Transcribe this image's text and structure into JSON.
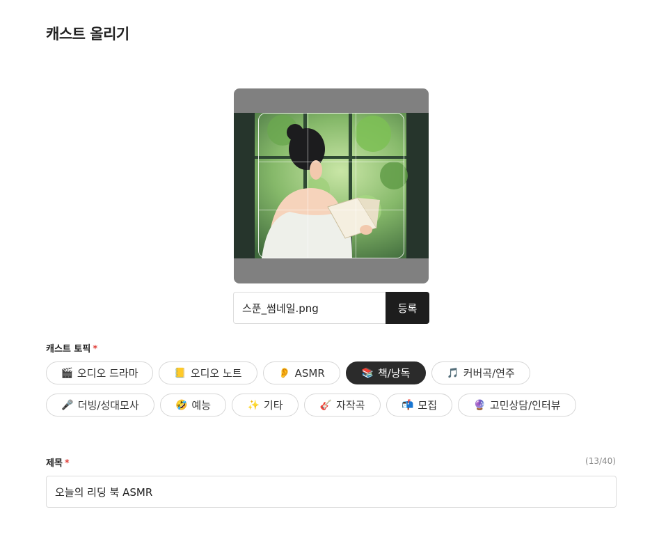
{
  "page": {
    "title": "캐스트 올리기"
  },
  "thumbnail": {
    "file_name": "스푼_썸네일.png",
    "upload_label": "등록"
  },
  "topic": {
    "label": "캐스트 토픽",
    "required_mark": "*",
    "chips": [
      {
        "icon": "🎬",
        "icon_name": "clapper-board-icon",
        "label": "오디오 드라마",
        "selected": false
      },
      {
        "icon": "📒",
        "icon_name": "notebook-icon",
        "label": "오디오 노트",
        "selected": false
      },
      {
        "icon": "👂",
        "icon_name": "ear-icon",
        "label": "ASMR",
        "selected": false
      },
      {
        "icon": "📚",
        "icon_name": "books-icon",
        "label": "책/낭독",
        "selected": true
      },
      {
        "icon": "🎵",
        "icon_name": "music-note-icon",
        "label": "커버곡/연주",
        "selected": false
      },
      {
        "icon": "🎤",
        "icon_name": "microphone-icon",
        "label": "더빙/성대모사",
        "selected": false
      },
      {
        "icon": "🤣",
        "icon_name": "laughing-face-icon",
        "label": "예능",
        "selected": false
      },
      {
        "icon": "✨",
        "icon_name": "sparkles-icon",
        "label": "기타",
        "selected": false
      },
      {
        "icon": "🎸",
        "icon_name": "guitar-icon",
        "label": "자작곡",
        "selected": false
      },
      {
        "icon": "📬",
        "icon_name": "mailbox-icon",
        "label": "모집",
        "selected": false
      },
      {
        "icon": "🔮",
        "icon_name": "crystal-ball-icon",
        "label": "고민상담/인터뷰",
        "selected": false
      }
    ]
  },
  "title_field": {
    "label": "제목",
    "required_mark": "*",
    "counter": "(13/40)",
    "value": "오늘의 리딩 북 ASMR"
  },
  "colors": {
    "selected_chip_bg": "#2b2b2b",
    "required_mark": "#e0423c",
    "upload_button_bg": "#1d1d1d",
    "cropper_bg": "#808080"
  }
}
